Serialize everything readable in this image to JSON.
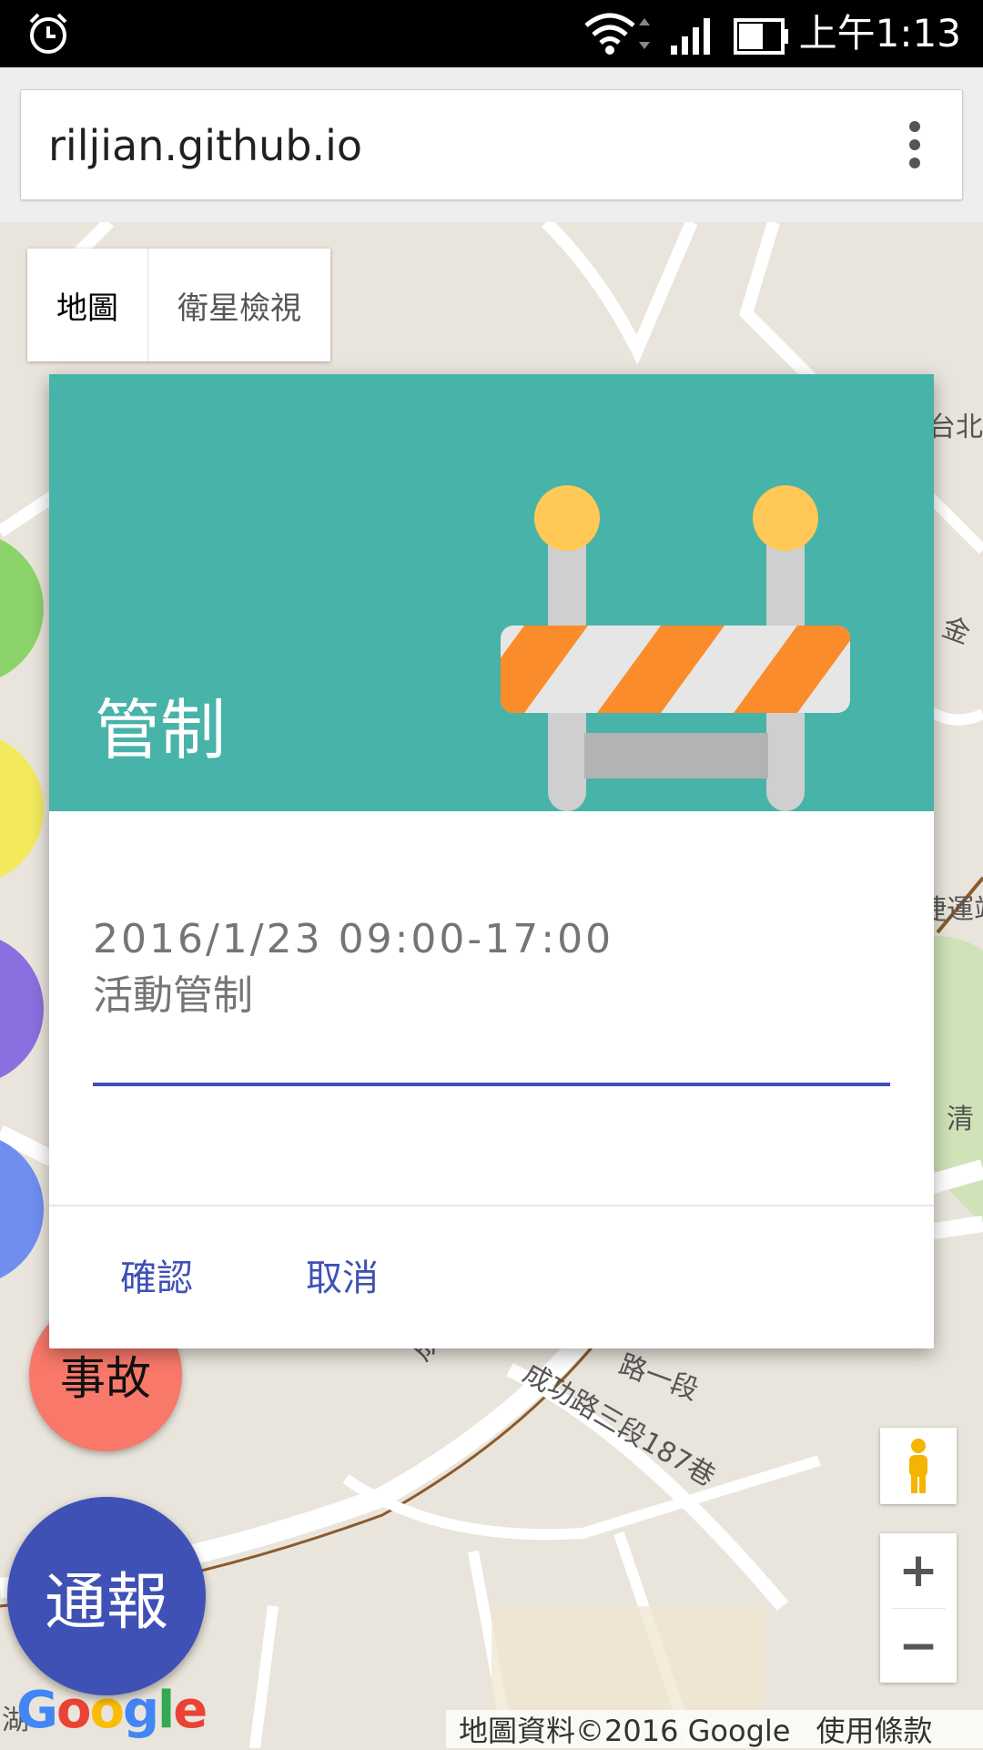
{
  "status_bar": {
    "time": "上午1:13"
  },
  "browser": {
    "url": "riljian.github.io"
  },
  "map": {
    "type_options": [
      "地圖",
      "衛星檢視"
    ],
    "attribution": [
      "地圖資料©2016 Google",
      "使用條款"
    ],
    "logo": "Google",
    "street_labels": [
      "成功路",
      "成功路三段187巷",
      "路一段",
      "台北",
      "金",
      "捷運站",
      "清",
      "湖",
      "巷"
    ]
  },
  "buttons": {
    "report": "通報",
    "accident": "事故"
  },
  "dialog": {
    "title": "管制",
    "line1": "2016/1/23  09:00-17:00",
    "line2": "活動管制",
    "confirm": "確認",
    "cancel": "取消"
  }
}
